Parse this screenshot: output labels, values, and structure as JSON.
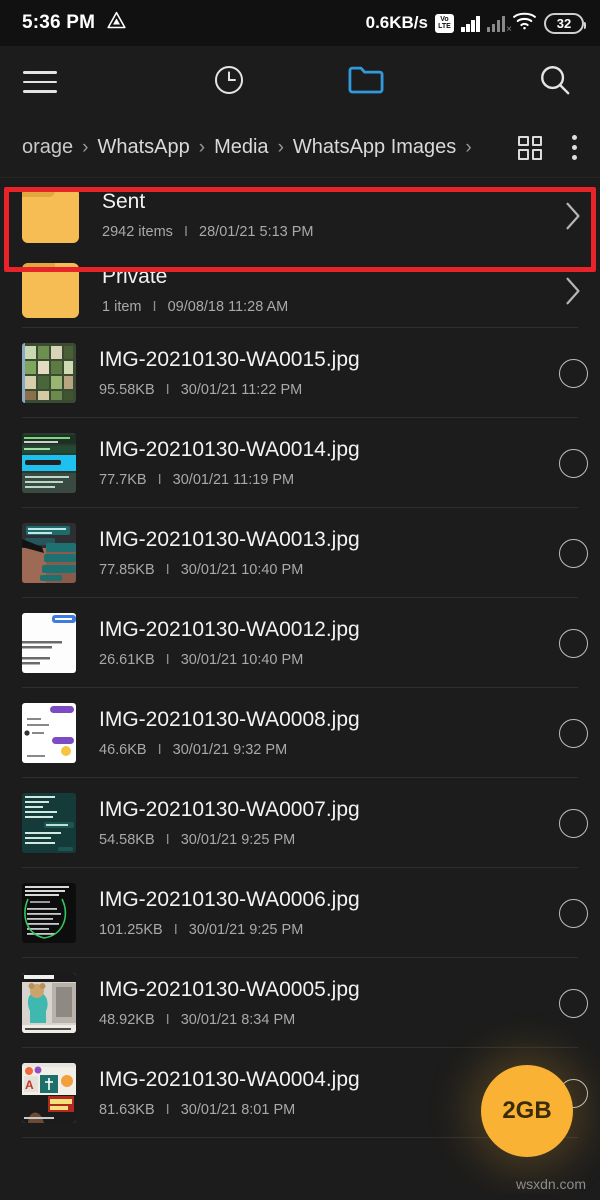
{
  "status_bar": {
    "time": "5:36 PM",
    "left_icon": "drive-triangle-icon",
    "network_speed": "0.6KB/s",
    "volte_top": "Vo",
    "volte_bottom": "LTE",
    "battery_level": "32"
  },
  "toolbar": {
    "menu_icon": "hamburger-menu-icon",
    "recent_icon": "clock-icon",
    "folder_icon": "folder-outline-icon",
    "search_icon": "search-icon",
    "active_color": "#3399dd"
  },
  "breadcrumb": {
    "items": [
      "orage",
      "WhatsApp",
      "Media",
      "WhatsApp Images"
    ],
    "separator": "›",
    "trailing_separator": "›",
    "grid_view_icon": "grid-view-icon",
    "overflow_icon": "more-vertical-icon"
  },
  "highlight": {
    "color": "#e8242a",
    "target": "sent-folder-row"
  },
  "fab": {
    "label": "2GB",
    "color": "#f9b233"
  },
  "watermark": "wsxdn.com",
  "list": [
    {
      "type": "folder",
      "name": "Sent",
      "count": "2942 items",
      "separator": "I",
      "modified": "28/01/21 5:13 PM",
      "accessory": "chevron-right-icon"
    },
    {
      "type": "folder",
      "name": "Private",
      "count": "1 item",
      "separator": "I",
      "modified": "09/08/18 11:28 AM",
      "accessory": "chevron-right-icon"
    },
    {
      "type": "file",
      "name": "IMG-20210130-WA0015.jpg",
      "size": "95.58KB",
      "separator": "I",
      "modified": "30/01/21 11:22 PM",
      "accessory": "checkbox-circle",
      "thumb": "collage-green"
    },
    {
      "type": "file",
      "name": "IMG-20210130-WA0014.jpg",
      "size": "77.7KB",
      "separator": "I",
      "modified": "30/01/21 11:19 PM",
      "accessory": "checkbox-circle",
      "thumb": "screenshot-cyan"
    },
    {
      "type": "file",
      "name": "IMG-20210130-WA0013.jpg",
      "size": "77.85KB",
      "separator": "I",
      "modified": "30/01/21 10:40 PM",
      "accessory": "checkbox-circle",
      "thumb": "chat-teal"
    },
    {
      "type": "file",
      "name": "IMG-20210130-WA0012.jpg",
      "size": "26.61KB",
      "separator": "I",
      "modified": "30/01/21 10:40 PM",
      "accessory": "checkbox-circle",
      "thumb": "chat-white-blue"
    },
    {
      "type": "file",
      "name": "IMG-20210130-WA0008.jpg",
      "size": "46.6KB",
      "separator": "I",
      "modified": "30/01/21 9:32 PM",
      "accessory": "checkbox-circle",
      "thumb": "chat-white-purple"
    },
    {
      "type": "file",
      "name": "IMG-20210130-WA0007.jpg",
      "size": "54.58KB",
      "separator": "I",
      "modified": "30/01/21 9:25 PM",
      "accessory": "checkbox-circle",
      "thumb": "chat-dark-teal"
    },
    {
      "type": "file",
      "name": "IMG-20210130-WA0006.jpg",
      "size": "101.25KB",
      "separator": "I",
      "modified": "30/01/21 9:25 PM",
      "accessory": "checkbox-circle",
      "thumb": "note-dark-green"
    },
    {
      "type": "file",
      "name": "IMG-20210130-WA0005.jpg",
      "size": "48.92KB",
      "separator": "I",
      "modified": "30/01/21 8:34 PM",
      "accessory": "checkbox-circle",
      "thumb": "teddy-photo"
    },
    {
      "type": "file",
      "name": "IMG-20210130-WA0004.jpg",
      "size": "81.63KB",
      "separator": "I",
      "modified": "30/01/21 8:01 PM",
      "accessory": "checkbox-circle",
      "thumb": "poster-collage"
    }
  ]
}
